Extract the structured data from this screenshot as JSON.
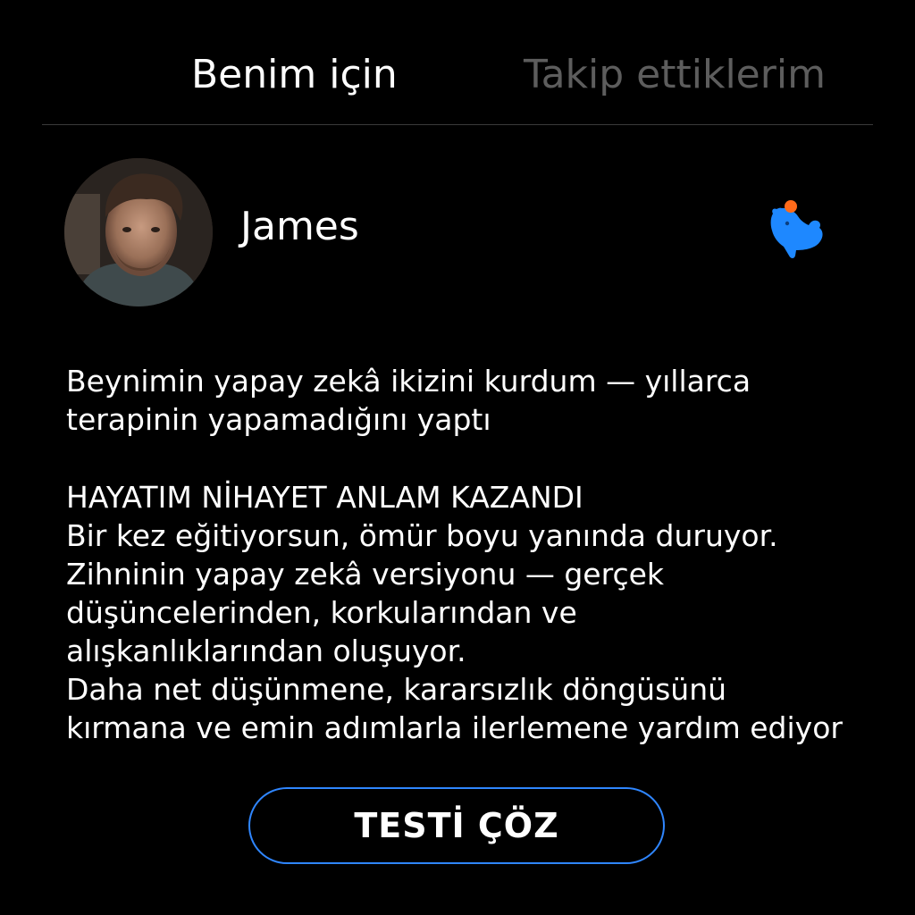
{
  "tabs": {
    "active_label": "Benim için",
    "inactive_label": "Takip ettiklerim"
  },
  "profile": {
    "name": "James",
    "brand_icon": "capybara-icon"
  },
  "post": {
    "headline_lines": [
      "Beynimin yapay zekâ ikizini kurdum — yıllarca",
      "terapinin yapamadığını yaptı"
    ],
    "body_lines": [
      "HAYATIM NİHAYET ANLAM KAZANDI",
      "Bir kez eğitiyorsun, ömür boyu yanında duruyor.",
      "Zihninin yapay zekâ versiyonu — gerçek",
      "düşüncelerinden, korkularından ve",
      "alışkanlıklarından oluşuyor.",
      "Daha net düşünmene, kararsızlık döngüsünü",
      "kırmana ve emin adımlarla ilerlemene yardım ediyor"
    ]
  },
  "cta": {
    "label": "TESTİ ÇÖZ"
  },
  "colors": {
    "background": "#000000",
    "text": "#ffffff",
    "inactive_tab": "#5d5d5d",
    "accent": "#2f86ff",
    "brand_blue": "#1e88ff",
    "brand_orange": "#ff6a1a"
  }
}
